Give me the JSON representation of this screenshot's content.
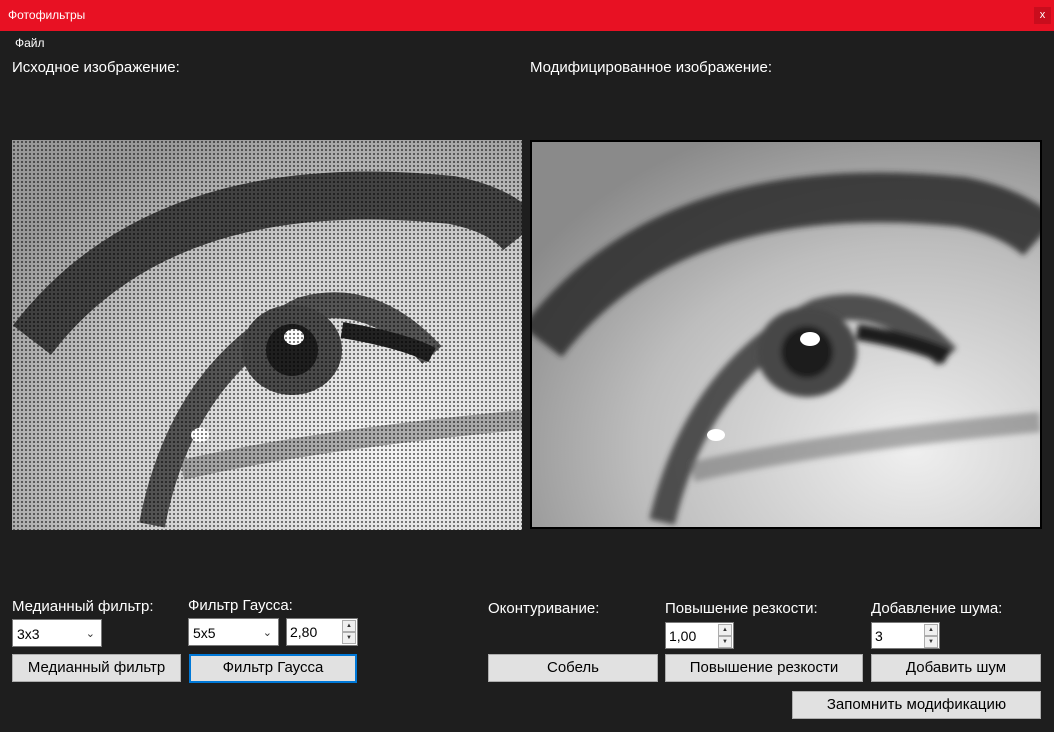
{
  "window": {
    "title": "Фотофильтры",
    "close_label": "x"
  },
  "menu": {
    "file": "Файл"
  },
  "labels": {
    "original": "Исходное изображение:",
    "modified": "Модифицированное изображение:",
    "median": "Медианный фильтр:",
    "gauss": "Фильтр Гаусса:",
    "contour": "Оконтуривание:",
    "sharpen": "Повышение резкости:",
    "noise": "Добавление шума:"
  },
  "controls": {
    "median_size": "3x3",
    "gauss_size": "5x5",
    "gauss_sigma": "2,80",
    "sharpen_value": "1,00",
    "noise_value": "3"
  },
  "buttons": {
    "median": "Медианный фильтр",
    "gauss": "Фильтр Гаусса",
    "sobel": "Собель",
    "sharpen": "Повышение резкости",
    "noise": "Добавить шум",
    "remember": "Запомнить модификацию"
  }
}
